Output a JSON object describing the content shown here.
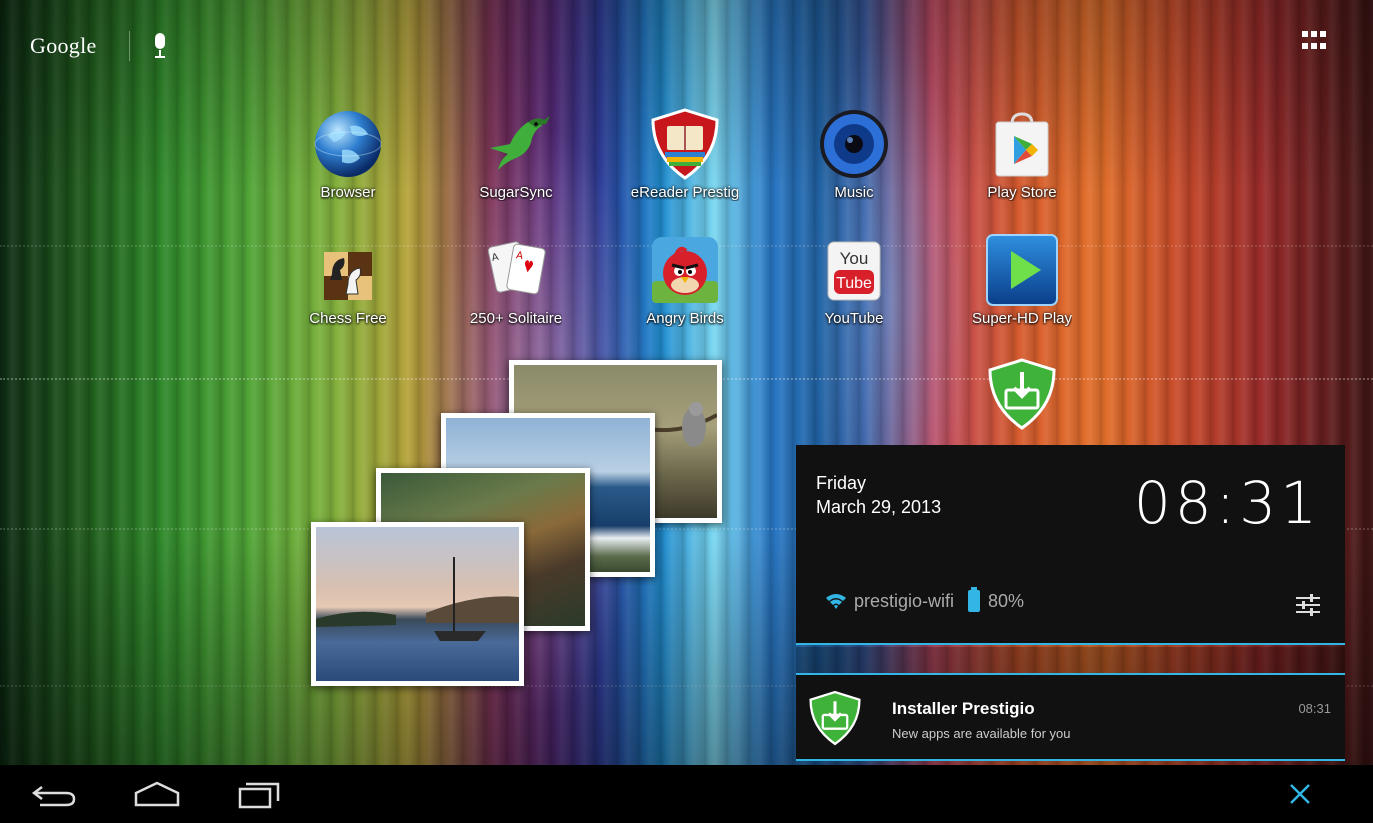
{
  "search_bar": {
    "logo": "Google",
    "mic_icon": "mic-icon"
  },
  "launcher": {
    "all_apps_icon": "grid-icon"
  },
  "apps": [
    {
      "label": "Browser",
      "icon": "globe-icon"
    },
    {
      "label": "SugarSync",
      "icon": "hummingbird-icon"
    },
    {
      "label": "eReader Prestig",
      "icon": "book-shield-icon"
    },
    {
      "label": "Music",
      "icon": "speaker-icon"
    },
    {
      "label": "Play Store",
      "icon": "play-store-icon"
    },
    {
      "label": "Chess Free",
      "icon": "chess-icon"
    },
    {
      "label": "250+ Solitaire",
      "icon": "cards-icon"
    },
    {
      "label": "Angry Birds",
      "icon": "red-bird-icon"
    },
    {
      "label": "YouTube",
      "icon": "youtube-icon"
    },
    {
      "label": "Super-HD Play",
      "icon": "video-play-icon"
    }
  ],
  "notification_panel": {
    "day": "Friday",
    "date": "March 29, 2013",
    "time": "08:31",
    "wifi_name": "prestigio-wifi",
    "battery": "80%",
    "notification": {
      "title": "Installer Prestigio",
      "text": "New apps are available for you",
      "time": "08:31"
    }
  },
  "colors": {
    "accent": "#33b5e5",
    "panel_bg": "#111111",
    "nav_bg": "#000000"
  }
}
